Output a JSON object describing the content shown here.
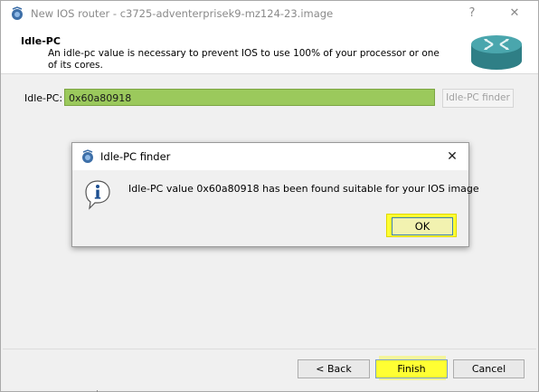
{
  "window": {
    "title": "New IOS router - c3725-adventerprisek9-mz124-23.image",
    "help_label": "?",
    "close_label": "✕"
  },
  "header": {
    "title": "Idle-PC",
    "description": "An idle-pc value is necessary to prevent IOS to use 100% of your processor or one of its cores."
  },
  "form": {
    "idlepc_label": "Idle-PC:",
    "idlepc_value": "0x60a80918",
    "finder_button": "Idle-PC finder"
  },
  "dialog": {
    "title": "Idle-PC finder",
    "close_label": "✕",
    "message": "Idle-PC value 0x60a80918 has been found suitable for your IOS image",
    "ok_label": "OK"
  },
  "footer": {
    "back_label": "< Back",
    "finish_label": "Finish",
    "cancel_label": "Cancel"
  },
  "colors": {
    "highlight": "#ffff33",
    "field_green": "#9bc95c"
  },
  "icons": {
    "app": "gns3-icon",
    "router": "router-icon",
    "info": "info-icon"
  }
}
